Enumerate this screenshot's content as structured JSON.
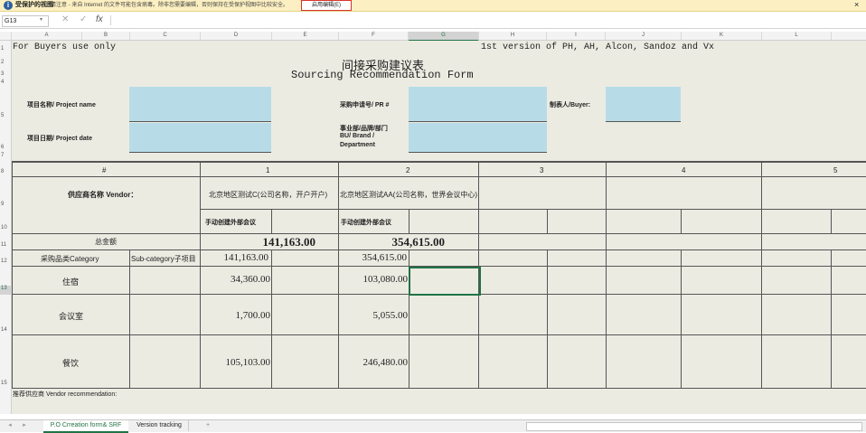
{
  "protected_view": {
    "title": "受保护的视图",
    "message": "请注意 - 来自 Internet 的文件可能包含病毒。除非您需要编辑，否则保持在受保护视图中比较安全。",
    "enable_button": "启用编辑(E)",
    "close": "×"
  },
  "formula_bar": {
    "name_box": "G13",
    "fx": "fx"
  },
  "columns": [
    "A",
    "B",
    "C",
    "D",
    "E",
    "F",
    "G",
    "H",
    "I",
    "J",
    "K",
    "L"
  ],
  "rows": [
    "1",
    "2",
    "3",
    "4",
    "5",
    "6",
    "7",
    "8",
    "9",
    "10",
    "11",
    "12",
    "13",
    "14",
    "15"
  ],
  "sheet": {
    "buyers_only": "For Buyers use only",
    "version_note": "1st version of PH, AH, Alcon, Sandoz and Vx",
    "title_cn": "间接采购建议表",
    "title_en": "Sourcing Recommendation Form",
    "project_name_label": "项目名称/ Project name",
    "project_date_label": "项目日期/ Project date",
    "pr_label": "采购申请号/ PR #",
    "bu_label_1": "事业部/品牌/部门",
    "bu_label_2": "BU/ Brand /",
    "bu_label_3": "Department",
    "buyer_label": "制表人/Buyer:",
    "hash": "#",
    "vendor_label": "供应商名称 Vendor：",
    "vendor_nums": [
      "1",
      "2",
      "3",
      "4",
      "5"
    ],
    "vendor1_name": "北京地区测试C(公司名称，开户开户)",
    "vendor2_name": "北京地区测试AA(公司名称，世界会议中心)",
    "vendor1_sub": "手动创建外部会议",
    "vendor2_sub": "手动创建外部会议",
    "total_label": "总金额",
    "total_v1": "141,163.00",
    "total_v2": "354,615.00",
    "category_label": "采购品类Category",
    "subcategory_label": "Sub-category子项目",
    "cat_v1": "141,163.00",
    "cat_v2": "354,615.00",
    "rows": [
      {
        "name": "住宿",
        "v1": "34,360.00",
        "v2": "103,080.00"
      },
      {
        "name": "会议室",
        "v1": "1,700.00",
        "v2": "5,055.00"
      },
      {
        "name": "餐饮",
        "v1": "105,103.00",
        "v2": "246,480.00"
      }
    ],
    "recommend_label": "推荐供应商 Vendor recommendation:"
  },
  "tabs": {
    "active": "P.O Crreation form& SRF",
    "second": "Version tracking",
    "add": "+"
  }
}
